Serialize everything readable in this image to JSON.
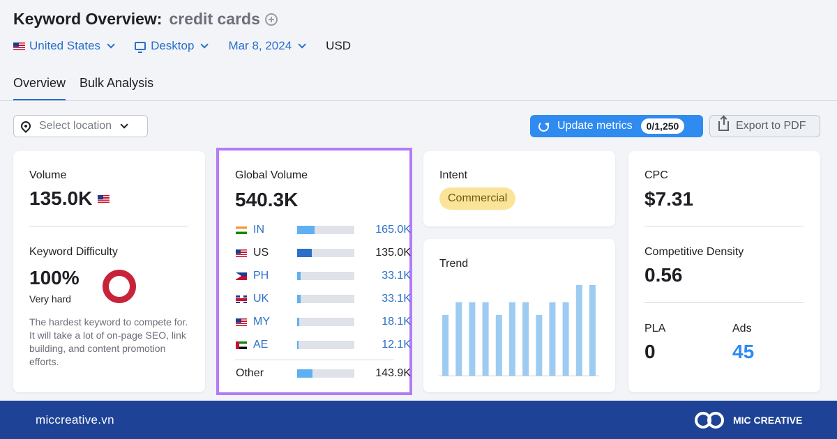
{
  "header": {
    "title": "Keyword Overview:",
    "keyword": "credit cards"
  },
  "filters": {
    "country": "United States",
    "device": "Desktop",
    "date": "Mar 8, 2024",
    "currency": "USD"
  },
  "tabs": [
    {
      "label": "Overview",
      "active": true
    },
    {
      "label": "Bulk Analysis",
      "active": false
    }
  ],
  "toolbar": {
    "location_placeholder": "Select location",
    "update_label": "Update metrics",
    "update_count": "0/1,250",
    "export_label": "Export to PDF"
  },
  "volume_card": {
    "volume_label": "Volume",
    "volume_value": "135.0K",
    "kd_label": "Keyword Difficulty",
    "kd_value": "100%",
    "kd_level": "Very hard",
    "kd_description": "The hardest keyword to compete for. It will take a lot of on-page SEO, link building, and content promotion efforts.",
    "kd_color": "#c7243a"
  },
  "global_volume": {
    "label": "Global Volume",
    "value": "540.3K",
    "rows": [
      {
        "code": "IN",
        "value": "165.0K",
        "share": 0.31
      },
      {
        "code": "US",
        "value": "135.0K",
        "share": 0.25
      },
      {
        "code": "PH",
        "value": "33.1K",
        "share": 0.06
      },
      {
        "code": "UK",
        "value": "33.1K",
        "share": 0.06
      },
      {
        "code": "MY",
        "value": "18.1K",
        "share": 0.04
      },
      {
        "code": "AE",
        "value": "12.1K",
        "share": 0.03
      }
    ],
    "other": {
      "code": "Other",
      "value": "143.9K",
      "share": 0.27
    }
  },
  "intent_card": {
    "label": "Intent",
    "value": "Commercial"
  },
  "trend_card": {
    "label": "Trend",
    "bar_color": "#9ecbf2"
  },
  "chart_data": {
    "type": "bar",
    "title": "Trend",
    "values": [
      67,
      81,
      81,
      81,
      67,
      81,
      81,
      67,
      81,
      81,
      100,
      100
    ],
    "ylim": [
      0,
      100
    ]
  },
  "cpc_card": {
    "cpc_label": "CPC",
    "cpc_value": "$7.31",
    "density_label": "Competitive Density",
    "density_value": "0.56",
    "pla_label": "PLA",
    "pla_value": "0",
    "ads_label": "Ads",
    "ads_value": "45"
  },
  "footer": {
    "site": "miccreative.vn",
    "brand": "MIC CREATIVE"
  }
}
